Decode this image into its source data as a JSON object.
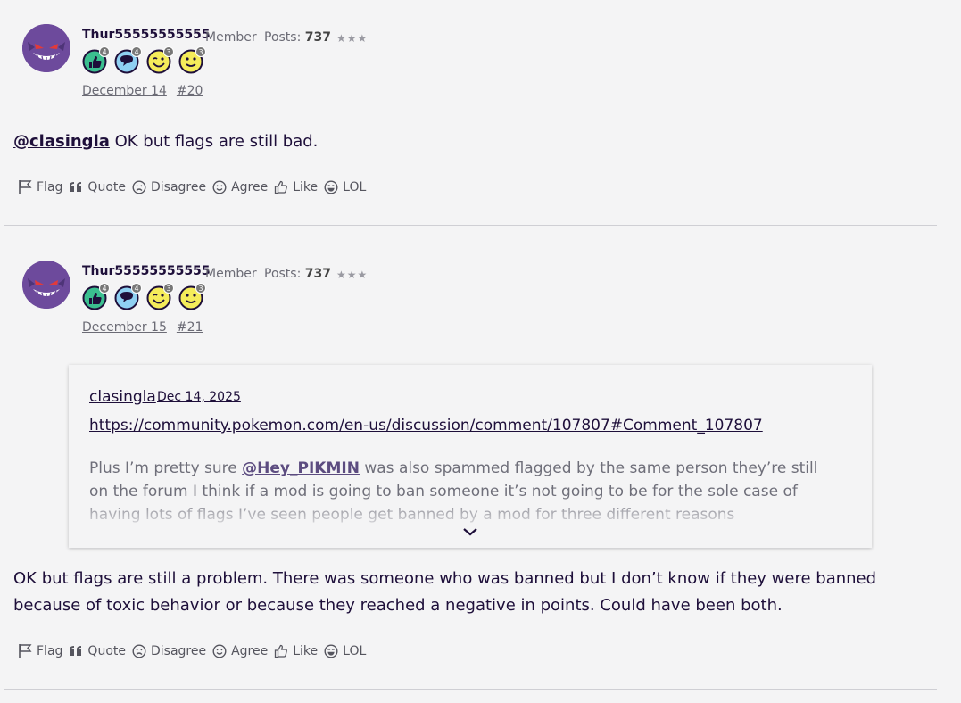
{
  "posts": [
    {
      "username": "Thur55555555555",
      "role": "Member",
      "posts_label": "Posts:",
      "posts_count": "737",
      "stars": "★★★",
      "badges": [
        {
          "icon": "thumbs-up-badge-icon",
          "count": "4",
          "color": "#3bbf8f"
        },
        {
          "icon": "comment-badge-icon",
          "count": "4",
          "color": "#5aa8e6"
        },
        {
          "icon": "wink-badge-icon",
          "count": "3",
          "color": "#f2e33a"
        },
        {
          "icon": "smile-badge-icon",
          "count": "3",
          "color": "#f2e33a"
        }
      ],
      "date": "December 14",
      "number": "#20",
      "mention": "@clasingla",
      "text": " OK but flags are still bad."
    },
    {
      "username": "Thur55555555555",
      "role": "Member",
      "posts_label": "Posts:",
      "posts_count": "737",
      "stars": "★★★",
      "badges": [
        {
          "icon": "thumbs-up-badge-icon",
          "count": "4",
          "color": "#3bbf8f"
        },
        {
          "icon": "comment-badge-icon",
          "count": "4",
          "color": "#5aa8e6"
        },
        {
          "icon": "wink-badge-icon",
          "count": "3",
          "color": "#f2e33a"
        },
        {
          "icon": "smile-badge-icon",
          "count": "3",
          "color": "#f2e33a"
        }
      ],
      "date": "December 15",
      "number": "#21",
      "quote": {
        "author": "clasingla",
        "date": "Dec 14, 2025",
        "link": "https://community.pokemon.com/en-us/discussion/comment/107807#Comment_107807",
        "text_before": "Plus I’m pretty sure ",
        "mention": "@Hey_PIKMIN",
        "text_after": " was also spammed flagged by the same person they’re still on the forum I think if a mod is going to ban someone it’s not going to be for the sole case of having lots of flags I’ve seen people get banned by a mod for three different reasons"
      },
      "text": "OK but flags are still a problem. There was someone who was banned but I don’t know if they were banned because of toxic behavior or because they reached a negative in points. Could have been both."
    }
  ],
  "reactions": {
    "flag": "Flag",
    "quote": "Quote",
    "disagree": "Disagree",
    "agree": "Agree",
    "like": "Like",
    "lol": "LOL"
  },
  "colors": {
    "text": "#1e0f3a",
    "muted": "#6b6b75",
    "background": "#f4f4f5",
    "avatar": "#6d4a9c"
  }
}
